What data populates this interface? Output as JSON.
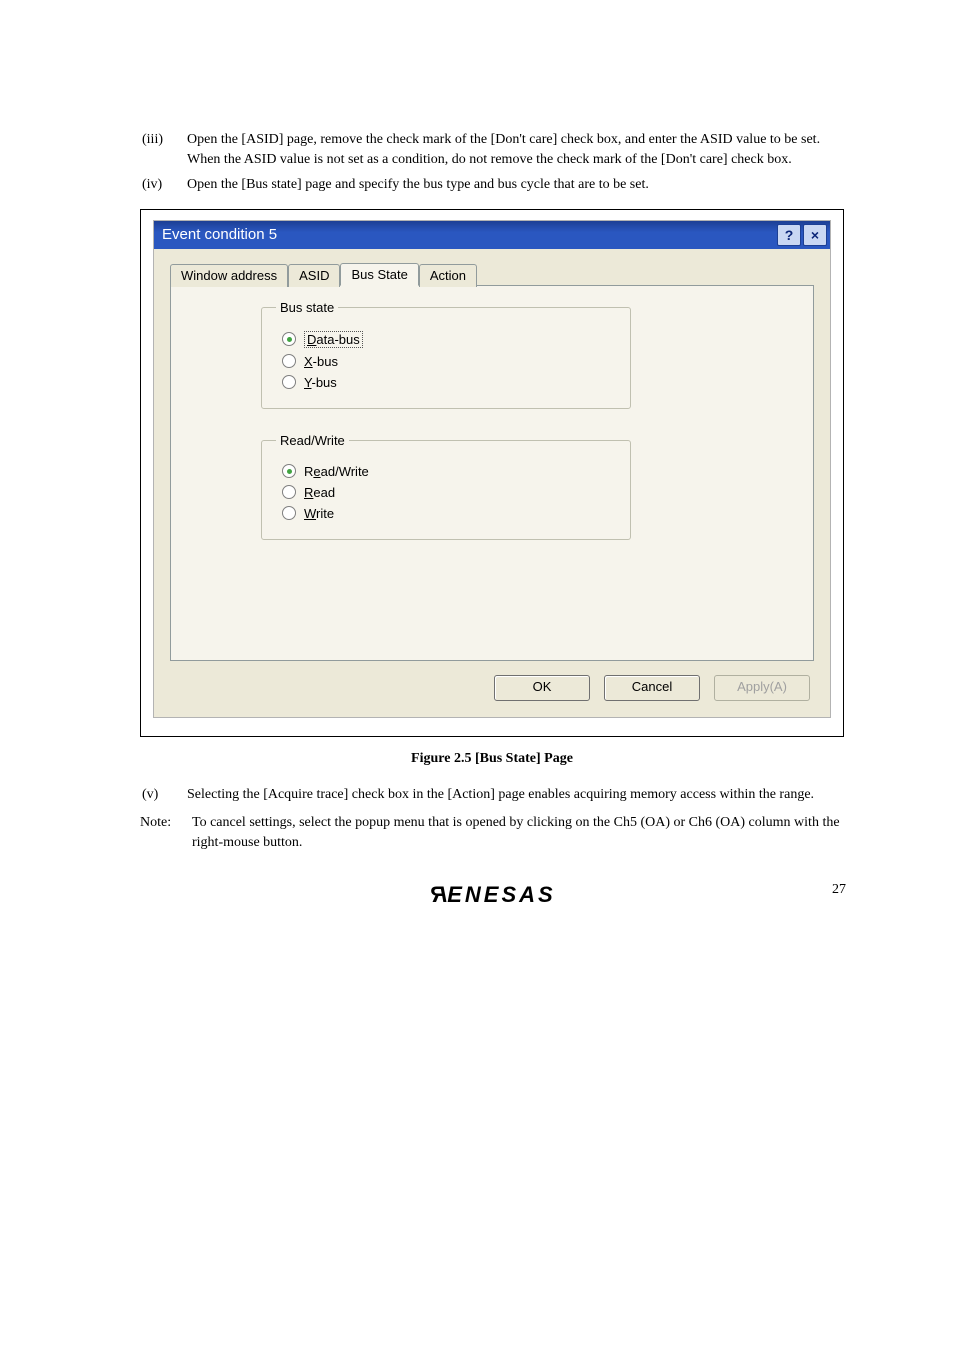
{
  "items": {
    "iii": {
      "marker": "(iii)",
      "line1": "Open the [ASID] page, remove the check mark of the [Don't care] check box, and enter the ASID value to be set.",
      "line2": "When the ASID value is not set as a condition, do not remove the check mark of the [Don't care] check box."
    },
    "iv": {
      "marker": "(iv)",
      "text": "Open the [Bus state] page and specify the bus type and bus cycle that are to be set."
    },
    "v": {
      "marker": "(v)",
      "text": "Selecting the [Acquire trace] check box in the [Action] page enables acquiring memory access within the range."
    }
  },
  "dialog": {
    "title": "Event condition 5",
    "help": "?",
    "close": "×",
    "tabs": {
      "t1": "Window address",
      "t2": "ASID",
      "t3": "Bus State",
      "t4": "Action"
    },
    "bus_state": {
      "legend": "Bus state",
      "data_pre": "D",
      "data_post": "ata-bus",
      "x_pre": "X",
      "x_post": "-bus",
      "y_pre": "Y",
      "y_post": "-bus"
    },
    "rw": {
      "legend": "Read/Write",
      "rw_pre": "R",
      "rw_mid": "e",
      "rw_post": "ad/Write",
      "r_pre": "R",
      "r_post": "ead",
      "w_pre": "W",
      "w_post": "rite"
    },
    "buttons": {
      "ok": "OK",
      "cancel": "Cancel",
      "apply": "Apply(A)"
    }
  },
  "caption": "Figure 2.5   [Bus State] Page",
  "note": {
    "label": "Note:",
    "text": "To cancel settings, select the popup menu that is opened by clicking on the Ch5 (OA) or Ch6 (OA) column with the right-mouse button."
  },
  "logo": {
    "r": "R",
    "rest": "ENESAS"
  },
  "page_number": "27"
}
